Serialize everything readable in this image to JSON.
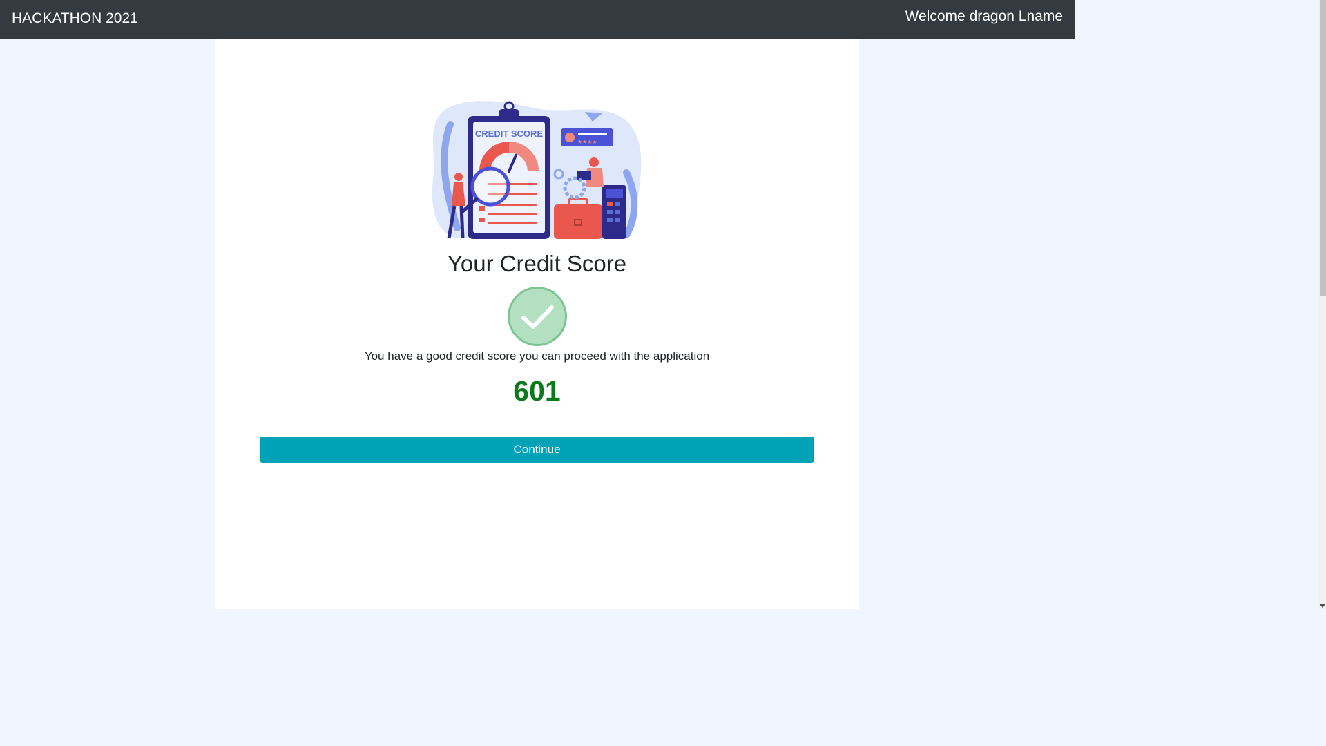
{
  "navbar": {
    "brand": "HACKATHON 2021",
    "welcome": "Welcome dragon Lname"
  },
  "illustration": {
    "clipboard_label": "CREDIT SCORE",
    "icon": "credit-score-illustration"
  },
  "main": {
    "title": "Your Credit Score",
    "status_icon": "check-icon",
    "message": "You have a good credit score you can proceed with the application",
    "score": "601",
    "continue_label": "Continue"
  },
  "colors": {
    "navbar": "#343a40",
    "background": "#f0f6ff",
    "score": "#0c7a1c",
    "button": "#00a2b8",
    "check": "#b3e0c0"
  }
}
